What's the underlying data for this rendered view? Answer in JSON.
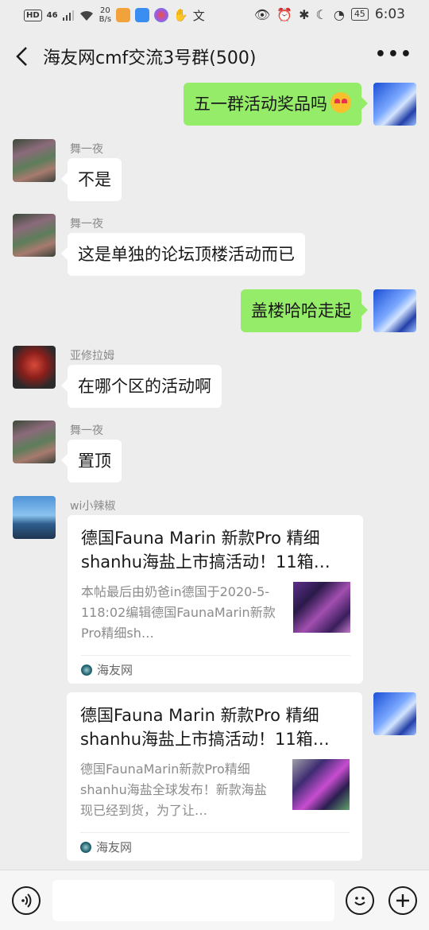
{
  "status_bar": {
    "hd": "HD",
    "signal": "46",
    "speed_value": "20",
    "speed_unit": "B/s",
    "battery": "45",
    "time": "6:03"
  },
  "header": {
    "title": "海友网cmf交流3号群(500)",
    "more": "•••"
  },
  "messages": [
    {
      "side": "right",
      "text": "五一群活动奖品吗",
      "emoji": "heart-eyes-emoji"
    },
    {
      "side": "left",
      "sender": "舞一夜",
      "text": "不是"
    },
    {
      "side": "left",
      "sender": "舞一夜",
      "text": "这是单独的论坛顶楼活动而已"
    },
    {
      "side": "right",
      "text": "盖楼哈哈走起"
    },
    {
      "side": "left",
      "sender": "亚修拉姆",
      "text": "在哪个区的活动啊"
    },
    {
      "side": "left",
      "sender": "舞一夜",
      "text": "置顶"
    },
    {
      "side": "left",
      "sender": "wi小辣椒",
      "type": "link",
      "title": "德国Fauna Marin 新款Pro 精细shanhu海盐上市搞活动！11箱…",
      "desc": "本帖最后由奶爸in德国于2020-5-118:02编辑德国FaunaMarin新款Pro精细sh…",
      "source": "海友网"
    },
    {
      "side": "right",
      "type": "link",
      "title": "德国Fauna Marin 新款Pro 精细shanhu海盐上市搞活动！11箱…",
      "desc": "德国FaunaMarin新款Pro精细shanhu海盐全球发布！新款海盐现已经到货，为了让…",
      "source": "海友网"
    }
  ],
  "input_bar": {
    "voice_icon": "voice-icon",
    "emoji_icon": "emoji-icon",
    "plus_icon": "plus-icon"
  }
}
